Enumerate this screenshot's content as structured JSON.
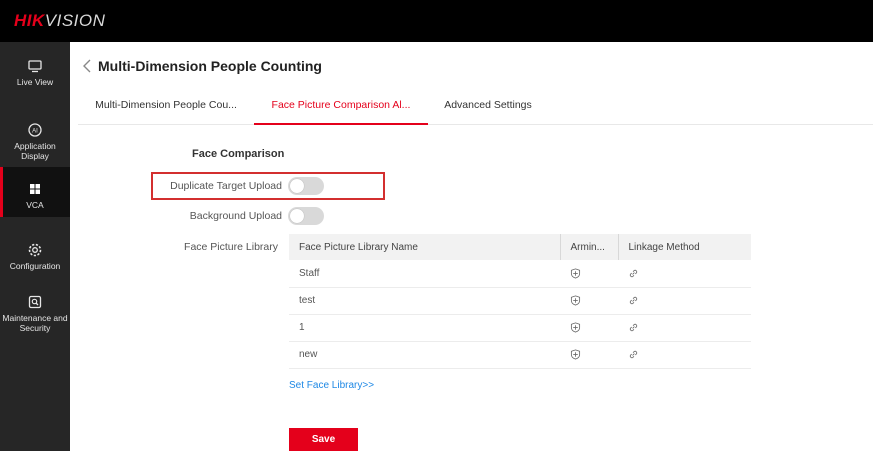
{
  "brand": {
    "logo_hik": "HIK",
    "logo_vision": "VISION",
    "accent": "#e4001b"
  },
  "sidebar": {
    "items": [
      {
        "label": "Live View",
        "icon": "monitor-icon"
      },
      {
        "label": "Application Display",
        "icon": "ai-icon"
      },
      {
        "label": "VCA",
        "icon": "grid-icon",
        "active": true
      },
      {
        "label": "Configuration",
        "icon": "gear-icon"
      },
      {
        "label": "Maintenance and Security",
        "icon": "maintenance-icon"
      }
    ]
  },
  "header": {
    "title": "Multi-Dimension People Counting"
  },
  "tabs": [
    {
      "label": "Multi-Dimension People Cou..."
    },
    {
      "label": "Face Picture Comparison Al...",
      "active": true
    },
    {
      "label": "Advanced Settings"
    }
  ],
  "form": {
    "section_title": "Face Comparison",
    "duplicate_upload": {
      "label": "Duplicate Target Upload",
      "enabled": false
    },
    "background_upload": {
      "label": "Background Upload",
      "enabled": false
    },
    "library_label": "Face Picture Library"
  },
  "library_table": {
    "headers": [
      "Face Picture Library Name",
      "Armin...",
      "Linkage Method"
    ],
    "rows": [
      {
        "name": "Staff"
      },
      {
        "name": "test"
      },
      {
        "name": "1"
      },
      {
        "name": "new"
      }
    ]
  },
  "links": {
    "set_face_library": "Set Face Library>>"
  },
  "buttons": {
    "save": "Save"
  }
}
